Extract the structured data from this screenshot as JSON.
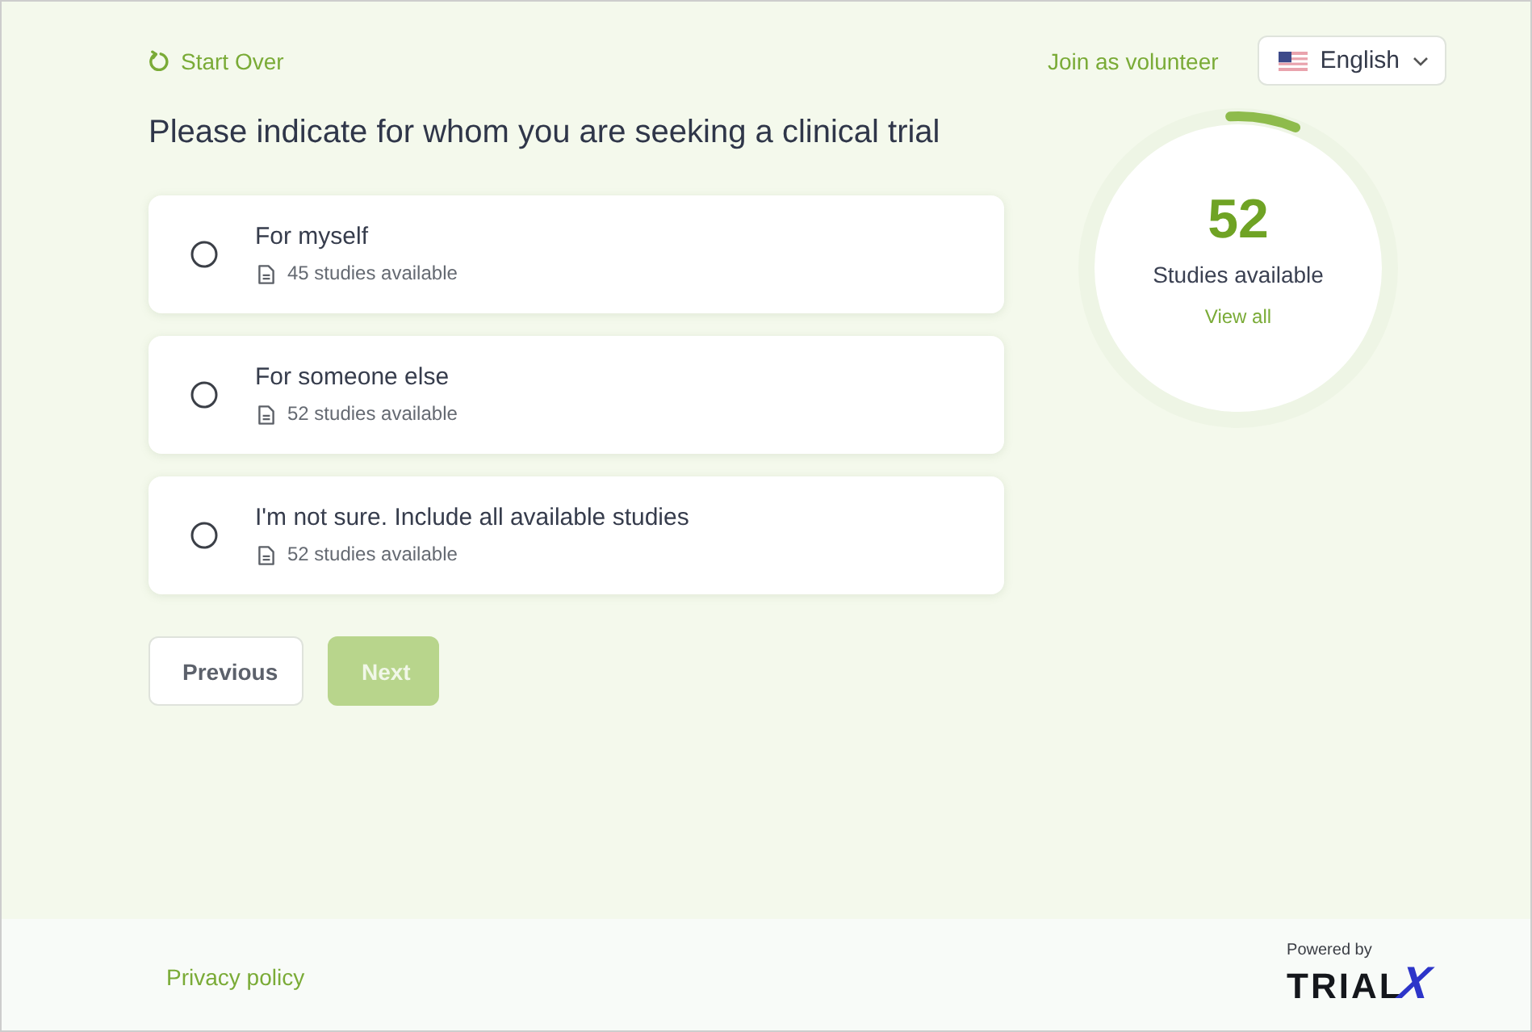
{
  "header": {
    "start_over": "Start Over",
    "join_link": "Join as volunteer",
    "language": {
      "label": "English"
    }
  },
  "question": {
    "title": "Please indicate for whom you are seeking a clinical trial"
  },
  "options": [
    {
      "label": "For myself",
      "count": "45 studies available",
      "selected": false
    },
    {
      "label": "For someone else",
      "count": "52 studies available",
      "selected": false
    },
    {
      "label": "I'm not sure. Include all available studies",
      "count": "52 studies available",
      "selected": false
    }
  ],
  "buttons": [
    {
      "kind": "secondary",
      "label": "Previous",
      "disabled": false
    },
    {
      "kind": "primary",
      "label": "Next",
      "disabled": true
    }
  ],
  "summary": {
    "count": "52",
    "label": "Studies available",
    "link": "View all",
    "level": 0.07
  },
  "footer": {
    "privacy_link": "Privacy policy",
    "powered_by": "Powered by",
    "logo": {
      "text": "TRIAL",
      "mark": "X"
    }
  }
}
